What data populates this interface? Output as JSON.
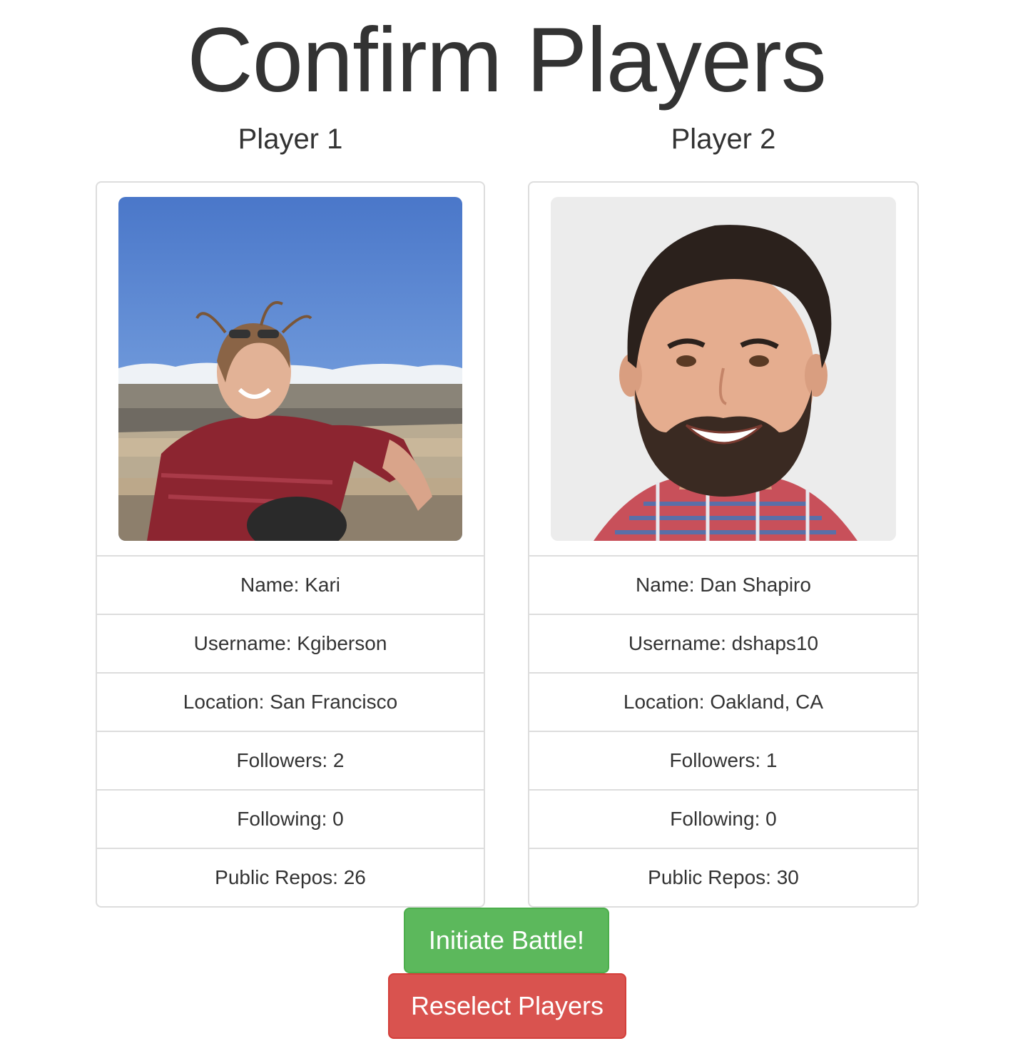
{
  "page": {
    "title": "Confirm Players"
  },
  "players": [
    {
      "heading": "Player 1",
      "name": "Name: Kari",
      "username": "Username: Kgiberson",
      "location": "Location: San Francisco",
      "followers": "Followers: 2",
      "following": "Following: 0",
      "public_repos": "Public Repos: 26"
    },
    {
      "heading": "Player 2",
      "name": "Name: Dan Shapiro",
      "username": "Username: dshaps10",
      "location": "Location: Oakland, CA",
      "followers": "Followers: 1",
      "following": "Following: 0",
      "public_repos": "Public Repos: 30"
    }
  ],
  "actions": {
    "battle_label": "Initiate Battle!",
    "reselect_label": "Reselect Players"
  },
  "colors": {
    "battle": "#5cb85c",
    "reselect": "#d9534f",
    "border": "#dddddd",
    "text": "#333333"
  }
}
